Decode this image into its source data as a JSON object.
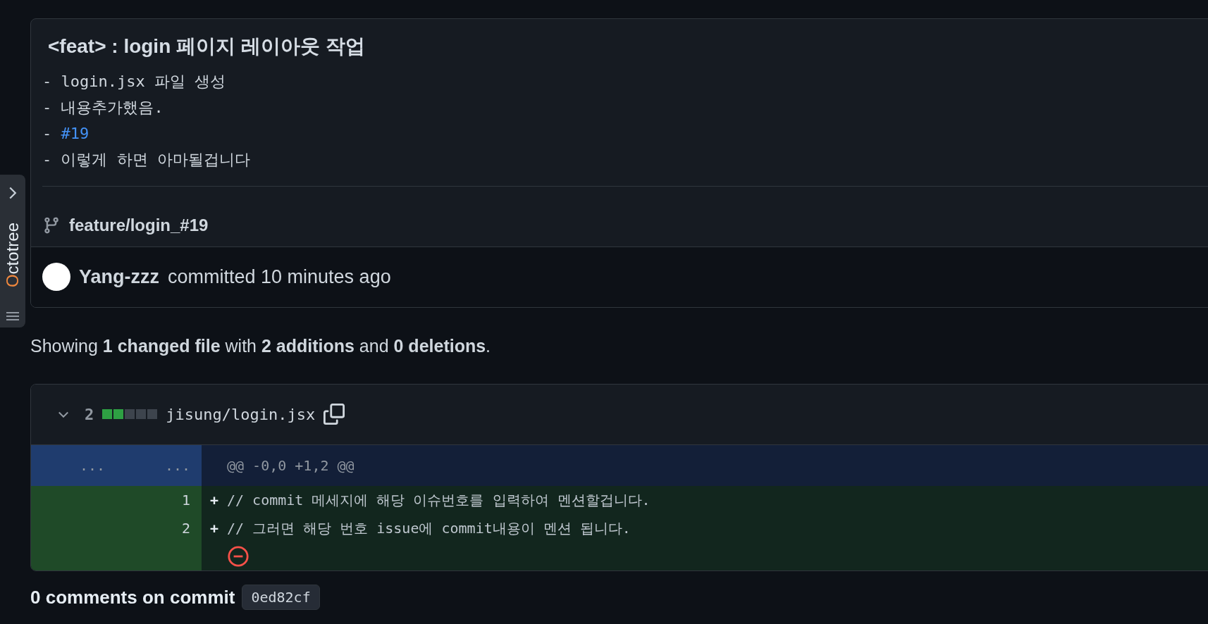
{
  "octotree": {
    "label": "Octotree"
  },
  "commit": {
    "title": "<feat> : login 페이지 레이아웃 작업",
    "body": [
      {
        "kind": "text",
        "text": "- login.jsx 파일 생성"
      },
      {
        "kind": "text",
        "text": "- 내용추가했음."
      },
      {
        "kind": "link",
        "prefix": "-",
        "text": "#19"
      },
      {
        "kind": "text",
        "text": "- 이렇게 하면 아마될겁니다"
      }
    ],
    "branch": "feature/login_#19",
    "author": "Yang-zzz",
    "action": "committed 10 minutes ago"
  },
  "summary": "Showing **1 changed file** with **2 additions** and **0 deletions**.",
  "file": {
    "expanded": true,
    "changes": "2",
    "stat_blocks": [
      {
        "kind": "added"
      },
      {
        "kind": "added"
      },
      {
        "kind": "neutral"
      },
      {
        "kind": "neutral"
      },
      {
        "kind": "neutral"
      }
    ],
    "path": "jisung/login.jsx",
    "lines": [
      {
        "kind": "hunk",
        "old": "...",
        "new": "...",
        "code": "@@ -0,0 +1,2 @@"
      },
      {
        "kind": "add",
        "new": "1",
        "sign": "+",
        "code": "// commit 메세지에 해당 이슈번호를 입력하여 멘션할겁니다."
      },
      {
        "kind": "add",
        "new": "2",
        "sign": "+",
        "code": "// 그러면 해당 번호 issue에 commit내용이 멘션 됩니다."
      },
      {
        "kind": "no-newline"
      }
    ]
  },
  "comments": {
    "heading": "0 comments on commit",
    "sha": "0ed82cf"
  }
}
